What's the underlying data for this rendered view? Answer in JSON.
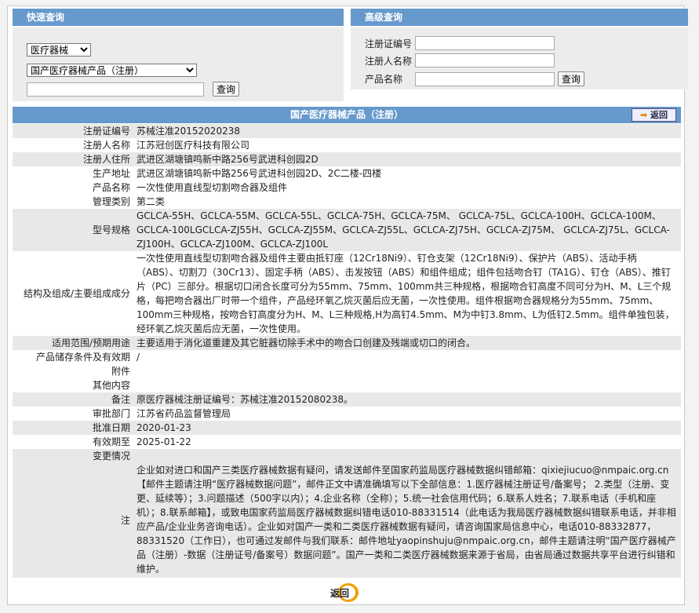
{
  "quick": {
    "title": "快速查询",
    "category": "医疗器械",
    "database": "国产医疗器械产品（注册）",
    "keyword": "",
    "search": "查询"
  },
  "advanced": {
    "title": "高级查询",
    "fields": [
      {
        "label": "注册证编号",
        "value": ""
      },
      {
        "label": "注册人名称",
        "value": ""
      },
      {
        "label": "产品名称",
        "value": ""
      }
    ],
    "search": "查询"
  },
  "detail": {
    "title": "国产医疗器械产品（注册）",
    "back": "返回",
    "rows": [
      {
        "label": "注册证编号",
        "value": "苏械注准20152020238"
      },
      {
        "label": "注册人名称",
        "value": "江苏冠创医疗科技有限公司"
      },
      {
        "label": "注册人住所",
        "value": "武进区湖塘镇鸣新中路256号武进科创园2D"
      },
      {
        "label": "生产地址",
        "value": "武进区湖塘镇鸣新中路256号武进科创园2D、2C二楼-四楼"
      },
      {
        "label": "产品名称",
        "value": "一次性使用直线型切割吻合器及组件"
      },
      {
        "label": "管理类别",
        "value": "第二类"
      },
      {
        "label": "型号规格",
        "value": "GCLCA-55H、GCLCA-55M、GCLCA-55L、GCLCA-75H、GCLCA-75M、 GCLCA-75L、GCLCA-100H、GCLCA-100M、GCLCA-100LGCLCA-ZJ55H、GCLCA-ZJ55M、GCLCA-ZJ55L、GCLCA-ZJ75H、GCLCA-ZJ75M、 GCLCA-ZJ75L、GCLCA-ZJ100H、GCLCA-ZJ100M、GCLCA-ZJ100L"
      },
      {
        "label": "结构及组成/主要组成成分",
        "value": "一次性使用直线型切割吻合器及组件主要由抵钉座（12Cr18Ni9）、钉仓支架（12Cr18Ni9）、保护片（ABS）、活动手柄（ABS）、切割刀（30Cr13）、固定手柄（ABS）、击发按钮（ABS）和组件组成；组件包括吻合钉（TA1G）、钉仓（ABS）、推钉片（PC）三部分。根据切口闭合长度可分为55mm、75mm、100mm共三种规格，根据吻合钉高度不同可分为H、M、L三个规格，每把吻合器出厂时带一个组件，产品经环氧乙烷灭菌后应无菌，一次性使用。组件根据吻合器规格分为55mm、75mm、100mm三种规格，按吻合钉高度分为H、M、L三种规格,H为高钉4.5mm、M为中钉3.8mm、L为低钉2.5mm。组件单独包装，经环氧乙烷灭菌后应无菌，一次性使用。"
      },
      {
        "label": "适用范围/预期用途",
        "value": "主要适用于消化道重建及其它脏器切除手术中的吻合口创建及残端或切口的闭合。"
      },
      {
        "label": "产品储存条件及有效期",
        "value": "/"
      },
      {
        "label": "附件",
        "value": ""
      },
      {
        "label": "其他内容",
        "value": ""
      },
      {
        "label": "备注",
        "value": "原医疗器械注册证编号：苏械注准20152080238。"
      },
      {
        "label": "审批部门",
        "value": "江苏省药品监督管理局"
      },
      {
        "label": "批准日期",
        "value": "2020-01-23"
      },
      {
        "label": "有效期至",
        "value": "2025-01-22"
      },
      {
        "label": "变更情况",
        "value": ""
      }
    ],
    "note_label": "注",
    "note": "企业如对进口和国产三类医疗器械数据有疑问，请发送邮件至国家药监局医疗器械数据纠错邮箱：qixiejiucuo@nmpaic.org.cn【邮件主题请注明“医疗器械数据问题”，邮件正文中请准确填写以下全部信息：1.医疗器械注册证号/备案号； 2.类型（注册、变更、延续等）；3.问题描述（500字以内）；4.企业名称（全称）；5.统一社会信用代码；6.联系人姓名；7.联系电话（手机和座机）；8.联系邮箱】，或致电国家药监局医疗器械数据纠错电话010-88331514（此电话为我局医疗器械数据纠错联系电话，并非相应产品/企业业务咨询电话）。企业如对国产一类和二类医疗器械数据有疑问，请咨询国家局信息中心，电话010-88332877，88331520（工作日），也可通过发邮件与我们联系：邮件地址yaopinshuju@nmpaic.org.cn，邮件主题请注明“国产医疗器械产品（注册）-数据（注册证号/备案号）数据问题”。国产一类和二类医疗器械数据来源于省局，由省局通过数据共享平台进行纠错和维护。",
    "bottom_back": "返回"
  }
}
